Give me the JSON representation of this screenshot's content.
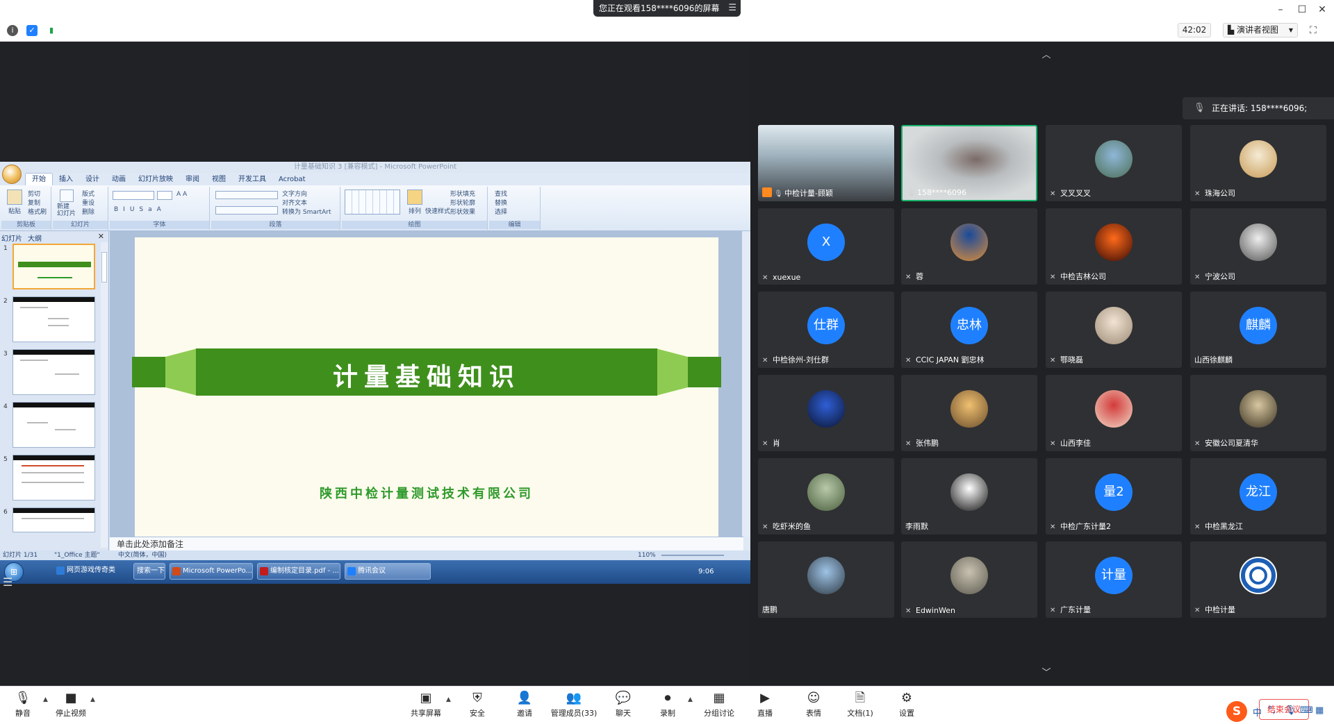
{
  "window": {
    "share_banner": "您正在观看158****6096的屏幕",
    "share_menu_icon": "menu-icon",
    "minimize": "–",
    "maximize": "☐",
    "close": "✕"
  },
  "toolbar": {
    "timer": "42:02",
    "view_mode": "演讲者视图",
    "info_icon": "info-icon",
    "shield_icon": "shield-icon",
    "signal_icon": "signal-icon"
  },
  "ppt": {
    "window_title": "计量基础知识 3 [兼容模式] - Microsoft PowerPoint",
    "tabs": [
      "开始",
      "插入",
      "设计",
      "动画",
      "幻灯片放映",
      "审阅",
      "视图",
      "开发工具",
      "Acrobat"
    ],
    "groups": {
      "clipboard": "剪贴板",
      "slides": "幻灯片",
      "font": "字体",
      "paragraph": "段落",
      "drawing": "绘图",
      "editing": "编辑"
    },
    "buttons": {
      "paste": "粘贴",
      "cut": "剪切",
      "copy": "复制",
      "format_painter": "格式刷",
      "new_slide": "新建\n幻灯片",
      "layout": "版式",
      "reset": "重设",
      "delete": "删除",
      "text_direction": "文字方向",
      "align_text": "对齐文本",
      "smartart": "转换为 SmartArt",
      "arrange": "排列",
      "quick_styles": "快速样式",
      "shape_fill": "形状填充",
      "shape_outline": "形状轮廓",
      "shape_effects": "形状效果",
      "find": "查找",
      "replace": "替换",
      "select": "选择"
    },
    "pane_tabs": [
      "幻灯片",
      "大纲"
    ],
    "slide_title": "计量基础知识",
    "slide_company": "陕西中检计量测试技术有限公司",
    "notes_placeholder": "单击此处添加备注",
    "status": {
      "slide_count": "幻灯片 1/31",
      "theme": "\"1_Office 主题\"",
      "language": "中文(简体，中国)",
      "zoom": "110%"
    },
    "taskbar": {
      "start": "⊞",
      "items": [
        "网页游戏传奇类",
        "搜索一下",
        "Microsoft PowerPo...",
        "编制核定目录.pdf - ...",
        "腾讯会议"
      ],
      "clock": "9:06"
    }
  },
  "panel": {
    "speaking_label": "正在讲话: 158****6096;",
    "participants": [
      {
        "name": "中检计量-顾颖",
        "avatar": "",
        "type": "video"
      },
      {
        "name": "158****6096",
        "avatar": "",
        "type": "video"
      },
      {
        "name": "叉叉叉叉",
        "avatar": "",
        "type": "photo"
      },
      {
        "name": "珠海公司",
        "avatar": "",
        "type": "photo"
      },
      {
        "name": "xuexue",
        "avatar": "X",
        "type": "text"
      },
      {
        "name": "蓉",
        "avatar": "",
        "type": "photo"
      },
      {
        "name": "中检吉林公司",
        "avatar": "",
        "type": "photo"
      },
      {
        "name": "宁波公司",
        "avatar": "",
        "type": "photo"
      },
      {
        "name": "中检徐州-刘仕群",
        "avatar": "仕群",
        "type": "text"
      },
      {
        "name": "CCIC JAPAN 劉忠林",
        "avatar": "忠林",
        "type": "text"
      },
      {
        "name": "鄂晓磊",
        "avatar": "",
        "type": "photo"
      },
      {
        "name": "山西徐麒麟",
        "avatar": "麒麟",
        "type": "text"
      },
      {
        "name": "肖",
        "avatar": "",
        "type": "photo"
      },
      {
        "name": "张伟鹏",
        "avatar": "",
        "type": "photo"
      },
      {
        "name": "山西李佳",
        "avatar": "",
        "type": "photo"
      },
      {
        "name": "安徽公司夏清华",
        "avatar": "",
        "type": "photo"
      },
      {
        "name": "吃虾米的鱼",
        "avatar": "",
        "type": "photo"
      },
      {
        "name": "李雨默",
        "avatar": "",
        "type": "photo"
      },
      {
        "name": "中检广东计量2",
        "avatar": "量2",
        "type": "text"
      },
      {
        "name": "中检黑龙江",
        "avatar": "龙江",
        "type": "text"
      },
      {
        "name": "唐鹏",
        "avatar": "",
        "type": "photo"
      },
      {
        "name": "EdwinWen",
        "avatar": "",
        "type": "photo"
      },
      {
        "name": "广东计量",
        "avatar": "计量",
        "type": "text"
      },
      {
        "name": "中检计量",
        "avatar": "",
        "type": "logo"
      }
    ]
  },
  "controls": {
    "mute": "静音",
    "stop_video": "停止视频",
    "share_screen": "共享屏幕",
    "security": "安全",
    "invite": "邀请",
    "manage_members": "管理成员(33)",
    "chat": "聊天",
    "record": "录制",
    "breakout": "分组讨论",
    "live": "直播",
    "reactions": "表情",
    "docs": "文档(1)",
    "settings": "设置",
    "end_meeting": "结束会议"
  },
  "ime": {
    "logo": "S",
    "lang": "中",
    "punct": "°,"
  },
  "colors": {
    "accent_blue": "#1f80ff",
    "speaker_green": "#18b46b",
    "slide_green": "#3f8f1c",
    "end_red": "#e33333"
  }
}
